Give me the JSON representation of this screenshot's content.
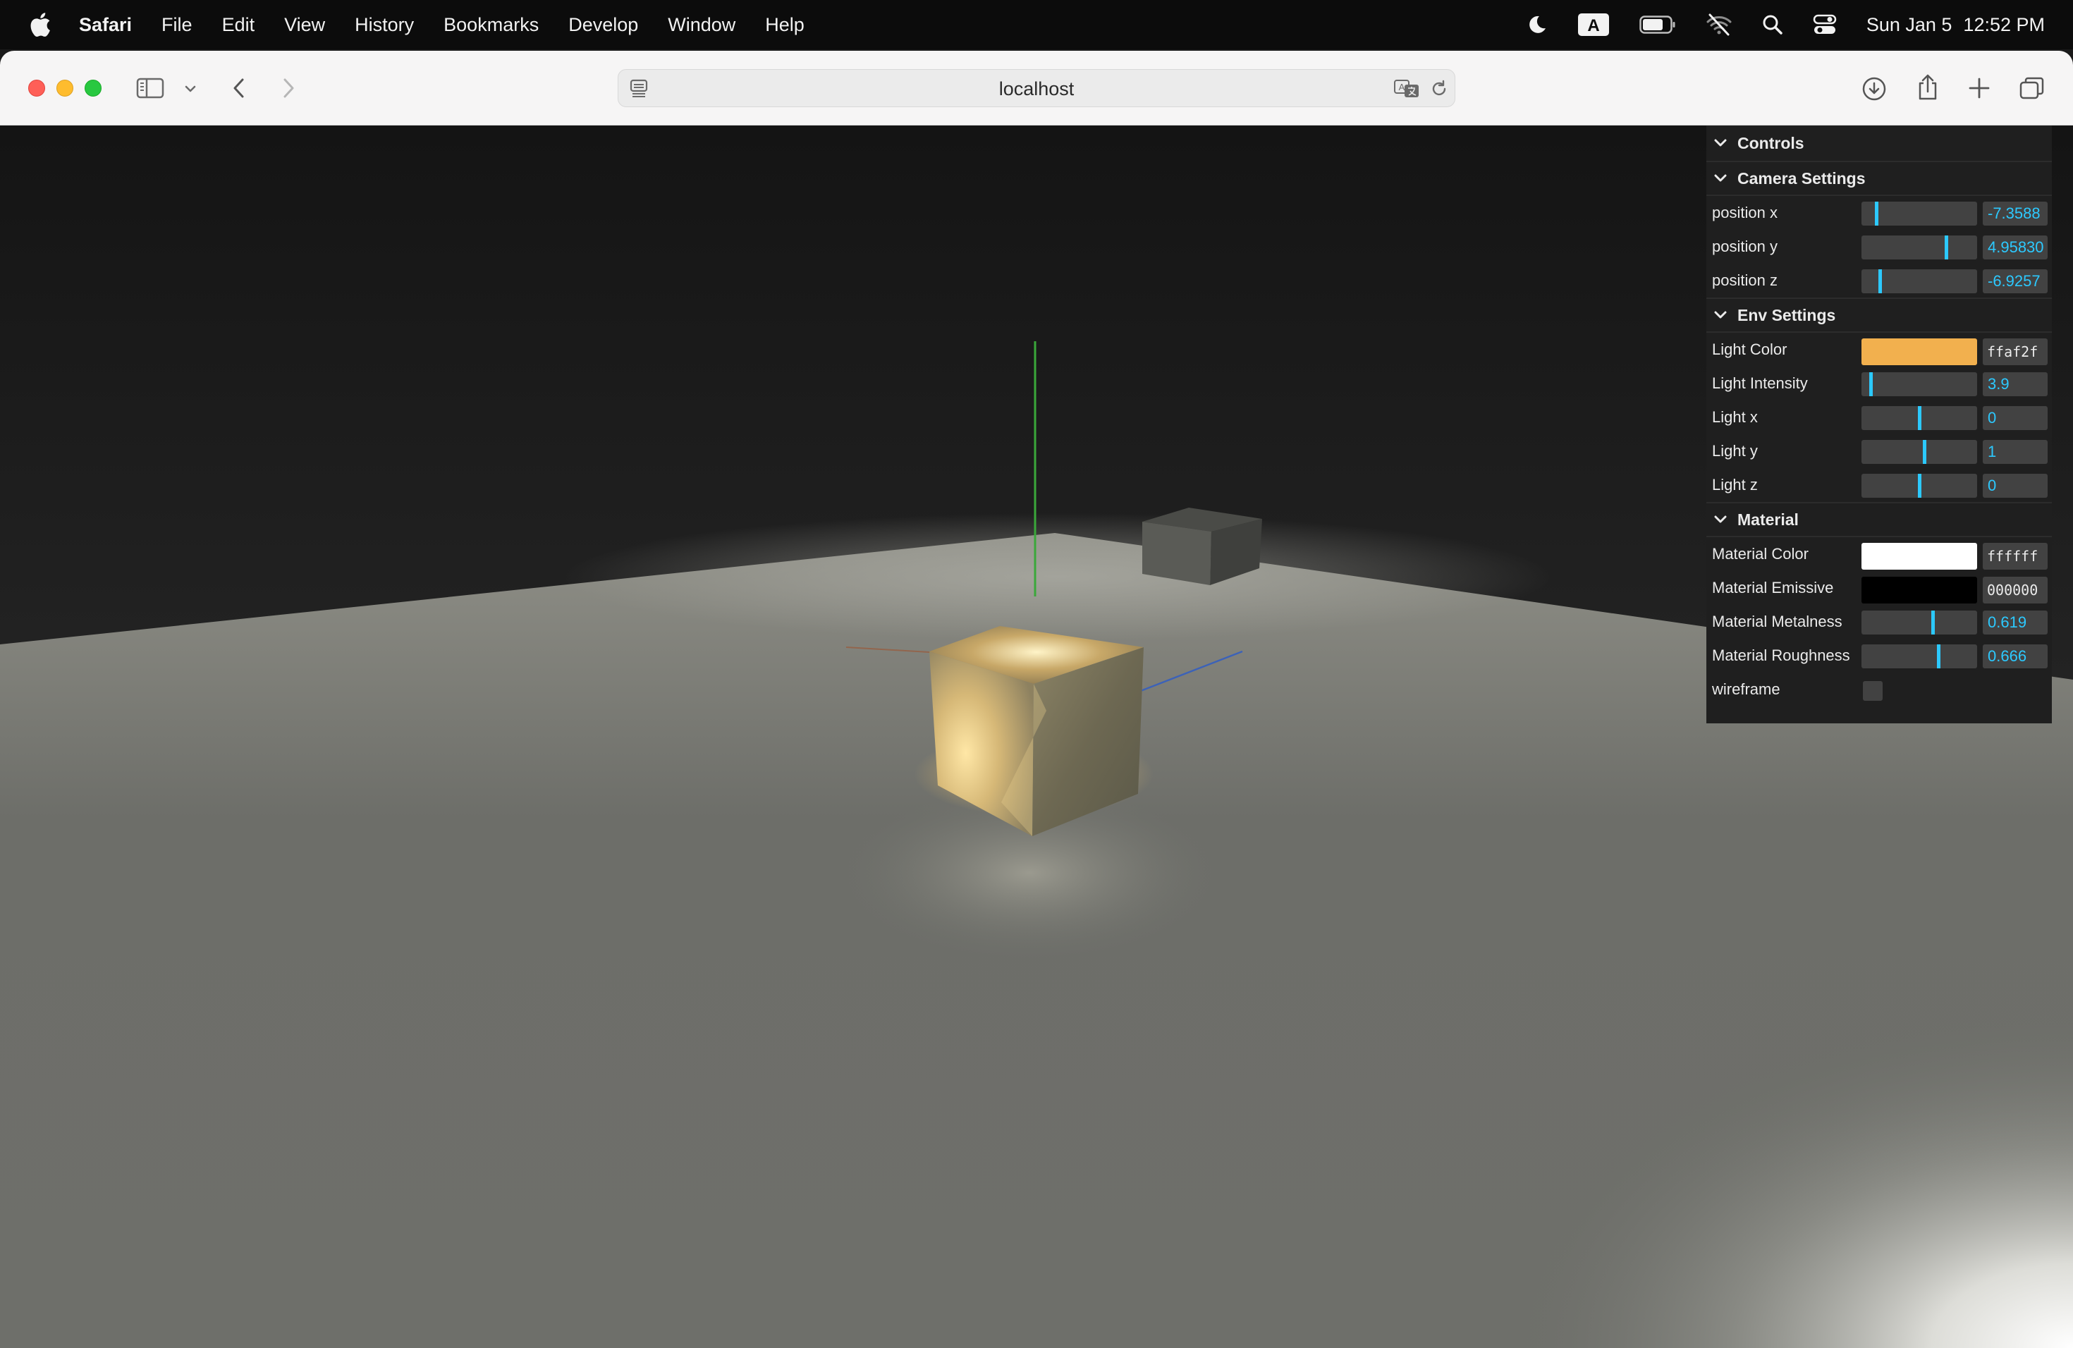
{
  "menubar": {
    "app_name": "Safari",
    "items": [
      "File",
      "Edit",
      "View",
      "History",
      "Bookmarks",
      "Develop",
      "Window",
      "Help"
    ],
    "input_source": "A",
    "clock_date": "Sun Jan 5",
    "clock_time": "12:52 PM"
  },
  "toolbar": {
    "url": "localhost"
  },
  "gui": {
    "title": "Controls",
    "camera": {
      "title": "Camera Settings",
      "position_x": {
        "label": "position x",
        "value": "-7.3588",
        "level": 0.12
      },
      "position_y": {
        "label": "position y",
        "value": "4.95830",
        "level": 0.74
      },
      "position_z": {
        "label": "position z",
        "value": "-6.9257",
        "level": 0.15
      }
    },
    "env": {
      "title": "Env Settings",
      "light_color": {
        "label": "Light Color",
        "value": "ffaf2f",
        "color": "#f2b04e"
      },
      "light_intensity": {
        "label": "Light Intensity",
        "value": "3.9",
        "level": 0.07
      },
      "light_x": {
        "label": "Light x",
        "value": "0",
        "level": 0.5
      },
      "light_y": {
        "label": "Light y",
        "value": "1",
        "level": 0.55
      },
      "light_z": {
        "label": "Light z",
        "value": "0",
        "level": 0.5
      }
    },
    "material": {
      "title": "Material",
      "color": {
        "label": "Material Color",
        "value": "ffffff",
        "color": "#ffffff"
      },
      "emissive": {
        "label": "Material Emissive",
        "value": "000000",
        "color": "#000000"
      },
      "metalness": {
        "label": "Material Metalness",
        "value": "0.619",
        "level": 0.62
      },
      "roughness": {
        "label": "Material Roughness",
        "value": "0.666",
        "level": 0.67
      },
      "wireframe": {
        "label": "wireframe",
        "checked": false
      }
    }
  },
  "colors": {
    "slider_accent": "#2cc9ff",
    "panel_bg": "#1f1f1f",
    "widget_bg": "#424242"
  }
}
